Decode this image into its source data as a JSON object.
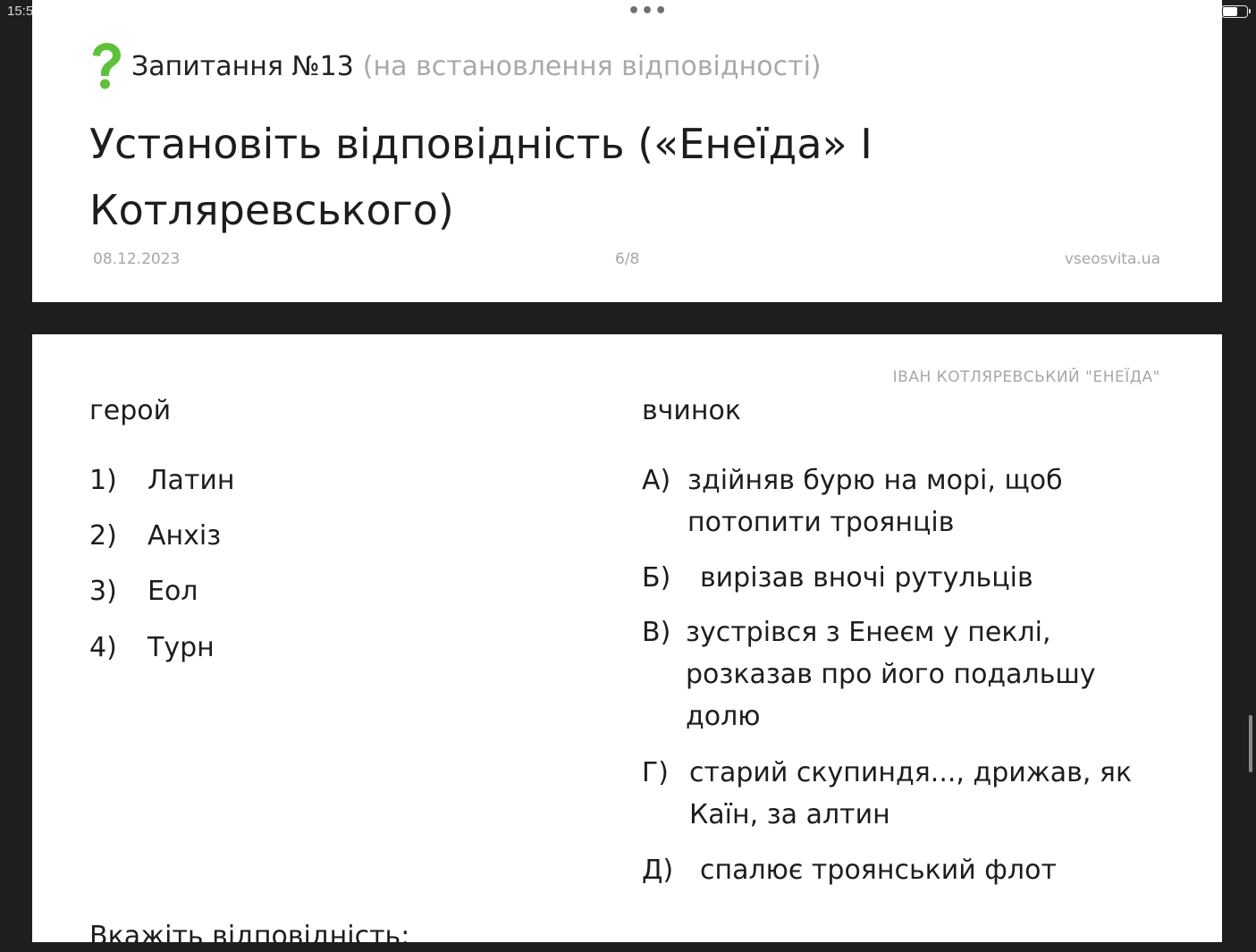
{
  "status_bar": {
    "time": "15:5"
  },
  "question": {
    "number_label": "Запитання №13",
    "type_label": "(на встановлення відповідності)",
    "title": "Установіть відповідність («Енеїда» І Котляревського)",
    "date": "08.12.2023",
    "page": "6/8",
    "site": "vseosvita.ua"
  },
  "content": {
    "topic": "ІВАН КОТЛЯРЕВСЬКИЙ \"ЕНЕЇДА\"",
    "left_header": "герой",
    "right_header": "вчинок",
    "heroes": [
      {
        "num": "1)",
        "name": "Латин"
      },
      {
        "num": "2)",
        "name": "Анхіз"
      },
      {
        "num": "3)",
        "name": "Еол"
      },
      {
        "num": "4)",
        "name": "Турн"
      }
    ],
    "actions": [
      {
        "letter": "А)",
        "text": "здійняв бурю на морі, щоб потопити троянців"
      },
      {
        "letter": "Б)",
        "text": "вирізав вночі рутульців"
      },
      {
        "letter": "В)",
        "text": "зустрівся з Енеєм у пеклі, розказав про його подальшу долю"
      },
      {
        "letter": "Г)",
        "text": "старий скупиндя..., дрижав, як Каїн, за алтин"
      },
      {
        "letter": "Д)",
        "text": "спалює троянський флот"
      }
    ],
    "answer_prompt": "Вкажіть відповідність:"
  },
  "colors": {
    "accent_green": "#5ec13a",
    "background_dark": "#1e1e1f",
    "muted_text": "#a7a7a7"
  },
  "icons": {
    "question_icon": "question-mark-icon",
    "more_icon": "more-dots-icon",
    "battery_icon": "battery-icon"
  }
}
